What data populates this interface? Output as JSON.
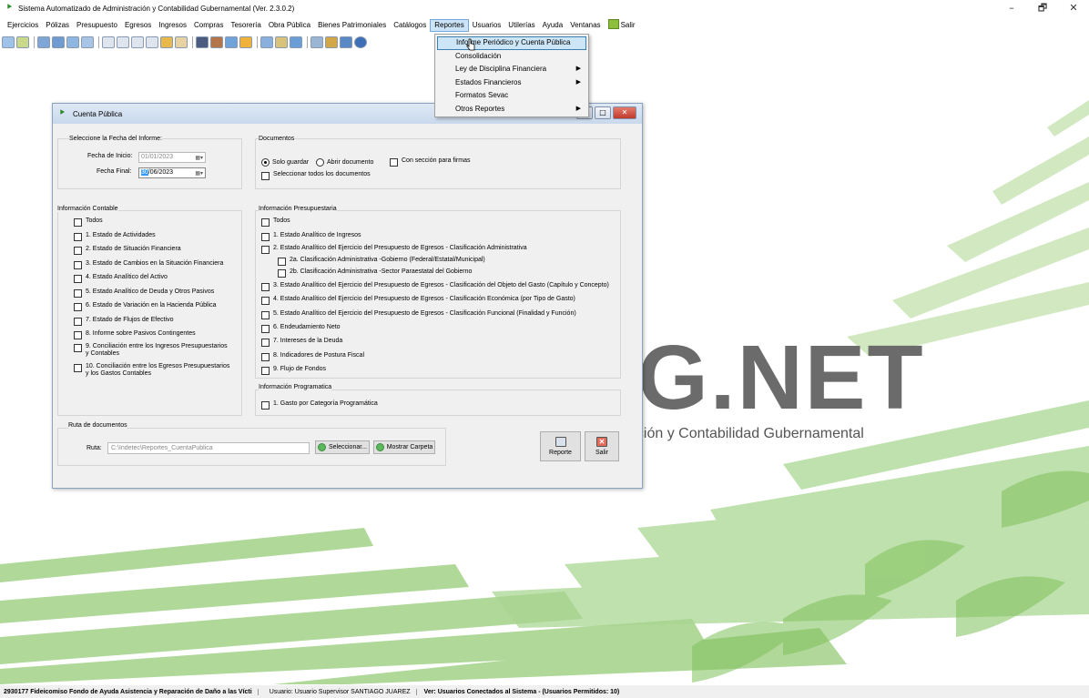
{
  "app": {
    "title": "Sistema Automatizado de Administración y Contabilidad Gubernamental  (Ver. 2.3.0.2)",
    "window_controls": [
      "–",
      "🗗",
      "✕"
    ]
  },
  "menu": [
    "Ejercicios",
    "Pólizas",
    "Presupuesto",
    "Egresos",
    "Ingresos",
    "Compras",
    "Tesorería",
    "Obra Pública",
    "Bienes Patrimoniales",
    "Catálogos",
    "Reportes",
    "Usuarios",
    "Utilerías",
    "Ayuda",
    "Ventanas",
    "Salir"
  ],
  "reportes_menu": [
    {
      "label": "Informe Periódico y Cuenta Pública",
      "submenu": false
    },
    {
      "label": "Consolidación",
      "submenu": false
    },
    {
      "label": "Ley de Disciplina Financiera",
      "submenu": true
    },
    {
      "label": "Estados Financieros",
      "submenu": true
    },
    {
      "label": "Formatos Sevac",
      "submenu": false
    },
    {
      "label": "Otros Reportes",
      "submenu": true
    }
  ],
  "brand": {
    "net": "G.NET",
    "tagline": "ación y Contabilidad Gubernamental"
  },
  "dialog": {
    "title": "Cuenta Pública",
    "fecha": {
      "group_label": "Seleccione la Fecha del Informe:",
      "inicio_label": "Fecha de Inicio:",
      "inicio_value": "01/01/2023",
      "final_label": "Fecha Final:",
      "final_day": "30",
      "final_rest": "/06/2023"
    },
    "documentos": {
      "group_label": "Documentos",
      "radio_solo": "Solo guardar",
      "radio_abrir": "Abrir documento",
      "check_firmas": "Con sección para firmas",
      "check_todos": "Seleccionar todos los documentos"
    },
    "contable": {
      "group_label": "Información Contable",
      "items": [
        "Todos",
        "1. Estado de Actividades",
        "2. Estado de Situación Financiera",
        "3. Estado de Cambios en la Situación Financiera",
        "4. Estado Analítico del Activo",
        "5. Estado Analítico de Deuda y Otros Pasivos",
        "6. Estado de Variación en la Hacienda Pública",
        "7. Estado de Flujos de Efectivo",
        "8. Informe sobre Pasivos Contingentes",
        "9. Conciliación entre los Ingresos Presupuestarios\ny Contables",
        "10. Conciliación entre los Egresos Presupuestarios\ny los Gastos Contables"
      ]
    },
    "presupuestaria": {
      "group_label": "Información Presupuestaria",
      "items": [
        "Todos",
        "1. Estado Analítico de Ingresos",
        "2. Estado Analítico del Ejercicio del Presupuesto de Egresos - Clasificación Administrativa",
        "2a. Clasificación Administrativa -Gobierno (Federal/Estatal/Municipal)",
        "2b. Clasificación Administrativa -Sector Paraestatal del Gobierno",
        "3. Estado Analítico del Ejercicio del Presupuesto de Egresos - Clasificación del Objeto del Gasto (Capítulo y Concepto)",
        "4. Estado Analítico del Ejercicio del Presupuesto de Egresos - Clasificación Económica (por Tipo de Gasto)",
        "5. Estado Analítico del Ejercicio del Presupuesto de Egresos - Clasificación Funcional (Finalidad y Función)",
        "6. Endeudamiento Neto",
        "7. Intereses de la Deuda",
        "8. Indicadores de Postura Fiscal",
        "9. Flujo de Fondos"
      ]
    },
    "programatica": {
      "group_label": "Información Programatica",
      "items": [
        "1. Gasto por Categoría Programática"
      ]
    },
    "ruta": {
      "group_label": "Ruta de documentos",
      "label": "Ruta:",
      "value": "C:\\Indetec\\Reportes_CuentaPublica",
      "btn_seleccionar": "Seleccionar...",
      "btn_mostrar": "Mostrar Carpeta"
    },
    "btn_reporte": "Reporte",
    "btn_salir": "Salir"
  },
  "status": {
    "entity": "2930177 Fideicomiso Fondo de Ayuda Asistencia y Reparación de Daño a las Vícti",
    "user": "Usuario: Usuario Supervisor SANTIAGO JUAREZ",
    "connected": "Ver: Usuarios Conectados al Sistema - (Usuarios Permitidos: 10)"
  }
}
